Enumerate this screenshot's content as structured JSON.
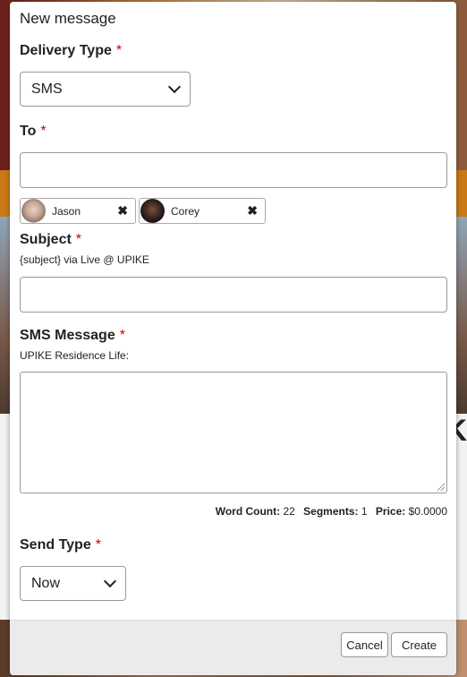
{
  "modal": {
    "title": "New message"
  },
  "form": {
    "delivery_type": {
      "label": "Delivery Type",
      "required": "*",
      "value": "SMS"
    },
    "to": {
      "label": "To",
      "required": "*",
      "value": "",
      "recipients": [
        {
          "name": "Jason",
          "remove": "✖"
        },
        {
          "name": "Corey",
          "remove": "✖"
        }
      ]
    },
    "subject": {
      "label": "Subject",
      "required": "*",
      "hint": "{subject} via Live @ UPIKE",
      "value": ""
    },
    "sms_message": {
      "label": "SMS Message",
      "required": "*",
      "hint": "UPIKE Residence Life:",
      "value": ""
    },
    "stats": {
      "word_count_label": "Word Count:",
      "word_count": "22",
      "segments_label": "Segments:",
      "segments": "1",
      "price_label": "Price:",
      "price": "$0.0000"
    },
    "send_type": {
      "label": "Send Type",
      "required": "*",
      "value": "Now"
    }
  },
  "footer": {
    "cancel_label": "Cancel",
    "create_label": "Create"
  },
  "background": {
    "fragment_text": "K"
  }
}
